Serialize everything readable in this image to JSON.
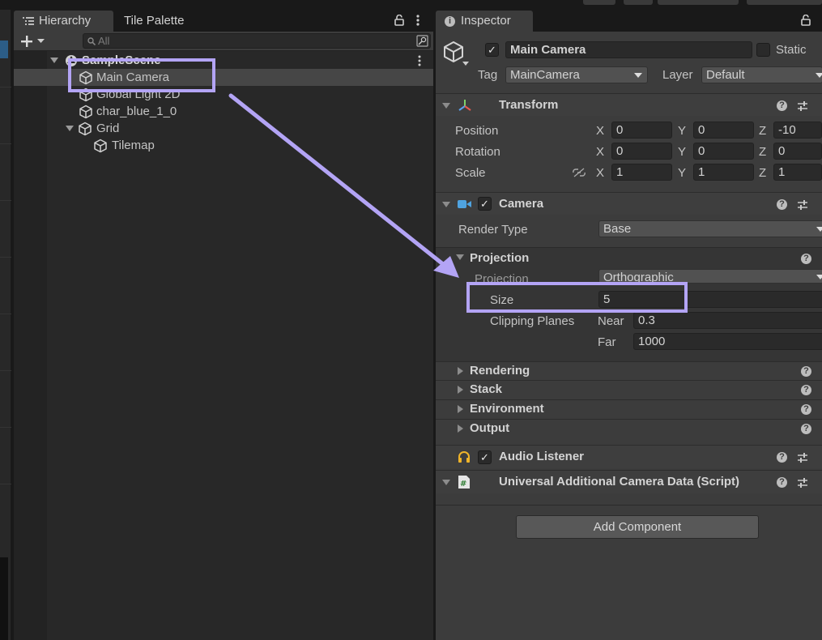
{
  "hierarchy": {
    "tab_hierarchy": "Hierarchy",
    "tab_palette": "Tile Palette",
    "search_placeholder": "All",
    "scene": "SampleScene",
    "items": [
      "Main Camera",
      "Global Light 2D",
      "char_blue_1_0",
      "Grid",
      "Tilemap"
    ]
  },
  "inspector": {
    "tab": "Inspector",
    "object_name": "Main Camera",
    "static_label": "Static",
    "tag_label": "Tag",
    "tag_value": "MainCamera",
    "layer_label": "Layer",
    "layer_value": "Default",
    "transform": {
      "title": "Transform",
      "position_label": "Position",
      "rotation_label": "Rotation",
      "scale_label": "Scale",
      "axis_x": "X",
      "axis_y": "Y",
      "axis_z": "Z",
      "position": [
        "0",
        "0",
        "-10"
      ],
      "rotation": [
        "0",
        "0",
        "0"
      ],
      "scale": [
        "1",
        "1",
        "1"
      ]
    },
    "camera": {
      "title": "Camera",
      "render_type_label": "Render Type",
      "render_type_value": "Base",
      "projection_section": "Projection",
      "projection_label": "Projection",
      "projection_value": "Orthographic",
      "size_label": "Size",
      "size_value": "5",
      "clipping_label": "Clipping Planes",
      "near_label": "Near",
      "near_value": "0.3",
      "far_label": "Far",
      "far_value": "1000",
      "sections": [
        "Rendering",
        "Stack",
        "Environment",
        "Output"
      ]
    },
    "audio_listener": "Audio Listener",
    "script_component": "Universal Additional Camera Data (Script)",
    "add_component": "Add Component"
  },
  "colors": {
    "highlight": "#b3a4f5",
    "selection": "#464646",
    "panel": "#282828",
    "inspector": "#3c3c3c",
    "audio_icon": "#f0b429",
    "camera_icon": "#4fa3e0"
  }
}
